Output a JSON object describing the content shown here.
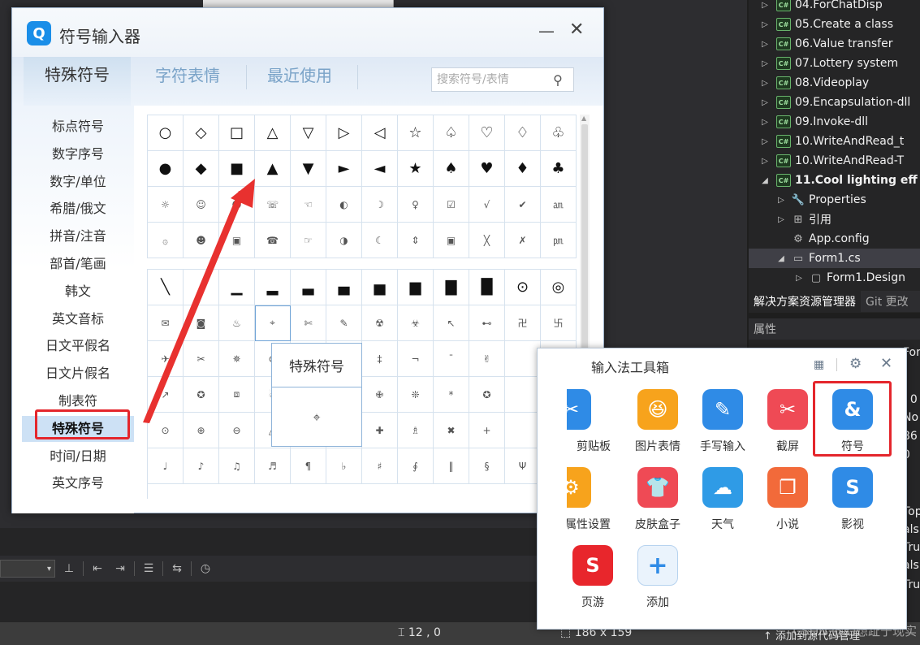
{
  "ide": {
    "solution_items": [
      {
        "label": "04.ForChatDisp",
        "icon": "cs"
      },
      {
        "label": "05.Create a class",
        "icon": "cs"
      },
      {
        "label": "06.Value transfer",
        "icon": "cs"
      },
      {
        "label": "07.Lottery system",
        "icon": "cs"
      },
      {
        "label": "08.Videoplay",
        "icon": "cs"
      },
      {
        "label": "09.Encapsulation-dll",
        "icon": "cs"
      },
      {
        "label": "09.Invoke-dll",
        "icon": "cs"
      },
      {
        "label": "10.WriteAndRead_t",
        "icon": "cs"
      },
      {
        "label": "10.WriteAndRead-T",
        "icon": "cs"
      },
      {
        "label": "11.Cool lighting eff",
        "icon": "cs",
        "bold": true
      },
      {
        "label": "Properties",
        "icon": "wrench"
      },
      {
        "label": "引用",
        "icon": "refs"
      },
      {
        "label": "App.config",
        "icon": "config"
      },
      {
        "label": "Form1.cs",
        "icon": "form",
        "selected": true
      },
      {
        "label": "Form1.Design",
        "icon": "file"
      }
    ],
    "solution_tab": "解决方案资源管理器",
    "git_tab": "Git 更改",
    "properties_header": "属性",
    "property_values": [
      "For",
      ", 0",
      "No",
      "86",
      "0",
      "Top",
      "als",
      "Tru",
      "als",
      "Tru"
    ],
    "status_cursor": "12 , 0",
    "status_size": "186 x 159",
    "status_add_source": "添加到源代码管理",
    "watermark": "CSDN @幻想趾于现实"
  },
  "symbol_window": {
    "title": "符号输入器",
    "tabs": [
      "特殊符号",
      "字符表情",
      "最近使用"
    ],
    "search_placeholder": "搜索符号/表情",
    "categories": [
      "标点符号",
      "数字序号",
      "数字/单位",
      "希腊/俄文",
      "拼音/注音",
      "部首/笔画",
      "韩文",
      "英文音标",
      "日文平假名",
      "日文片假名",
      "制表符",
      "特殊符号",
      "时间/日期",
      "英文序号"
    ],
    "selected_category": "特殊符号",
    "grid1": [
      [
        "○",
        "◇",
        "□",
        "△",
        "▽",
        "▷",
        "◁",
        "☆",
        "♤",
        "♡",
        "♢",
        "♧"
      ],
      [
        "●",
        "◆",
        "■",
        "▲",
        "▼",
        "►",
        "◄",
        "★",
        "♠",
        "♥",
        "♦",
        "♣"
      ],
      [
        "☼",
        "☺",
        "☻",
        "☏",
        "☜",
        "◐",
        "☽",
        "♀",
        "☑",
        "√",
        "✔",
        "㏂"
      ],
      [
        "۞",
        "☻",
        "▣",
        "☎",
        "☞",
        "◑",
        "☾",
        "⇕",
        "▣",
        "╳",
        "✗",
        "㏘"
      ]
    ],
    "grid2": [
      [
        "╲",
        "╱",
        "▁",
        "▂",
        "▃",
        "▄",
        "▅",
        "▆",
        "▇",
        "█",
        "⊙",
        "◎"
      ],
      [
        "✉",
        "◙",
        "♨",
        "⌖",
        "✄",
        "✎",
        "☢",
        "☣",
        "↖",
        "⊷",
        "卍",
        "卐"
      ],
      [
        "✈",
        "✂",
        "✵",
        "⊛",
        "",
        "",
        "",
        "",
        "◕",
        "†",
        "‡",
        "¬",
        "¯",
        "✌"
      ],
      [
        "↗",
        "✪",
        "⧈",
        "☃",
        "",
        "",
        "",
        "",
        "♚",
        "✳",
        "✙",
        "❊",
        "*",
        "✪"
      ],
      [
        "⊙",
        "⊕",
        "⊖",
        "△",
        "",
        "",
        "",
        "",
        "▣",
        "♡",
        "✚",
        "♗",
        "✖",
        "+"
      ],
      [
        "♩",
        "♪",
        "♫",
        "♬",
        "¶",
        "♭",
        "♯",
        "∮",
        "‖",
        "§",
        "Ψ",
        "✣"
      ]
    ],
    "tooltip_title": "特殊符号",
    "tooltip_symbol": "⌖"
  },
  "toolbox": {
    "title": "输入法工具箱",
    "tools": [
      {
        "label": "剪贴板",
        "icon": "✂",
        "color": "#2f8be6",
        "partial": true
      },
      {
        "label": "图片表情",
        "icon": "😆",
        "color": "#f7a31c"
      },
      {
        "label": "手写输入",
        "icon": "✎",
        "color": "#2f8be6"
      },
      {
        "label": "截屏",
        "icon": "✂",
        "color": "#ef4a55"
      },
      {
        "label": "符号",
        "icon": "&",
        "color": "#2f8be6"
      },
      {
        "label": "属性设置",
        "icon": "⚙",
        "color": "#f7a31c",
        "partial": true
      },
      {
        "label": "皮肤盒子",
        "icon": "👕",
        "color": "#ef4a55"
      },
      {
        "label": "天气",
        "icon": "☁",
        "color": "#2f9be6"
      },
      {
        "label": "小说",
        "icon": "❐",
        "color": "#f26a3a"
      },
      {
        "label": "影视",
        "icon": "S",
        "color": "#2f8be6"
      },
      {
        "label": "页游",
        "icon": "S",
        "color": "#e8262c"
      },
      {
        "label": "添加",
        "icon": "+",
        "color": "#eaf3fc"
      }
    ]
  }
}
